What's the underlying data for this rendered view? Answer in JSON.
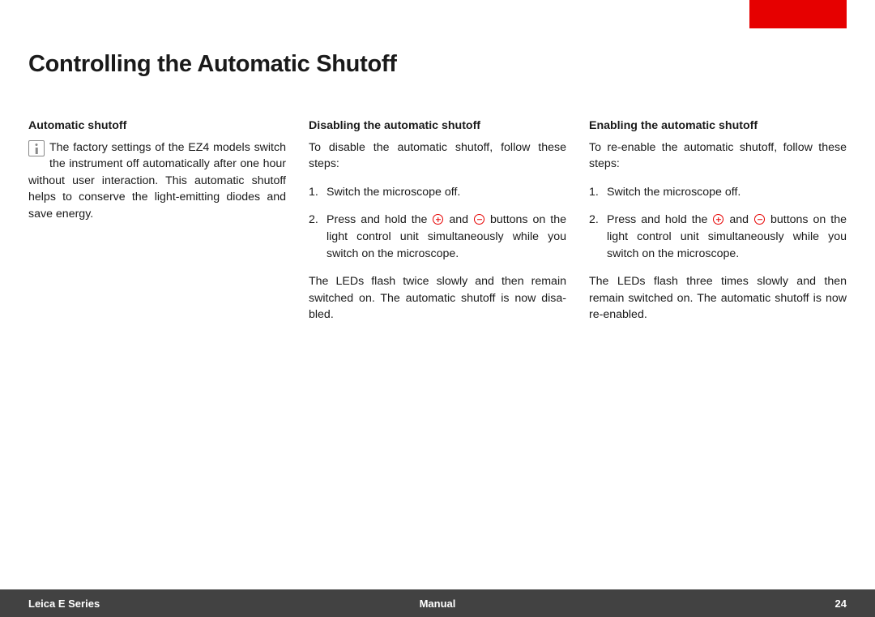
{
  "title": "Controlling the Automatic Shutoff",
  "col1": {
    "heading": "Automatic shutoff",
    "body": "The factory settings of the EZ4 models switch the instrument off automatically after one hour without user interaction. This automatic shutoff helps to conserve the light-emitting diodes and save energy."
  },
  "col2": {
    "heading": "Disabling the automatic shutoff",
    "intro": "To disable the automatic shutoff, follow these steps:",
    "step1": "Switch the microscope off.",
    "step2a": "Press and hold the ",
    "step2b": " and ",
    "step2c": " buttons on the light control unit simultaneously while you switch on the microscope.",
    "result": "The LEDs flash twice slowly and then remain switched on. The automatic shutoff is now disa­bled."
  },
  "col3": {
    "heading": "Enabling the automatic shutoff",
    "intro": "To re-enable the automatic shutoff, follow these steps:",
    "step1": "Switch the microscope off.",
    "step2a": "Press and hold the ",
    "step2b": " and ",
    "step2c": " buttons on the light control unit simultaneously while you switch on the microscope.",
    "result": "The LEDs flash three times slowly and then remain switched on. The automatic shutoff is now re-enabled."
  },
  "footer": {
    "left": "Leica E Series",
    "center": "Manual",
    "right": "24"
  }
}
